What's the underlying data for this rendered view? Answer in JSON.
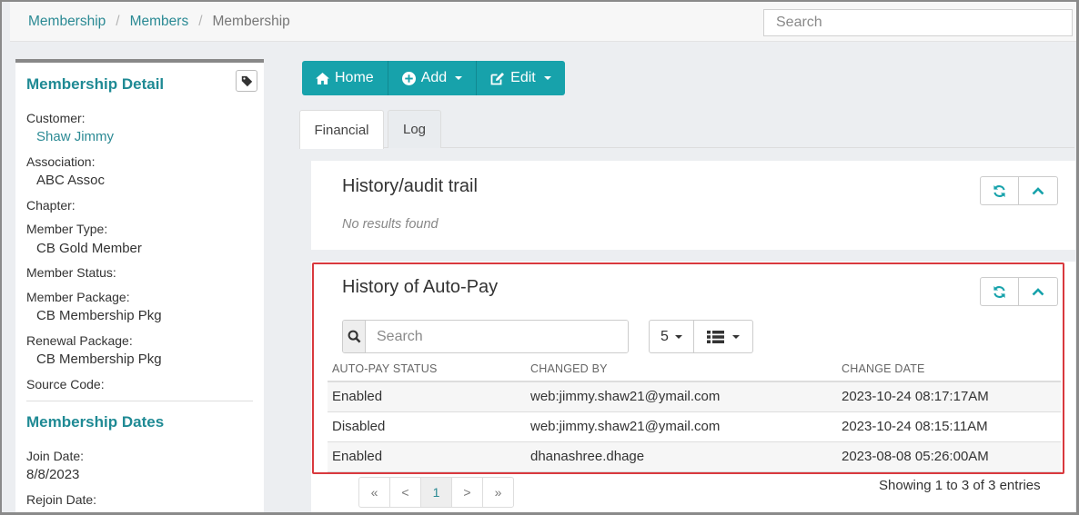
{
  "breadcrumb": {
    "items": [
      "Membership",
      "Members"
    ],
    "current": "Membership"
  },
  "top_search": {
    "placeholder": "Search"
  },
  "detail": {
    "title": "Membership Detail",
    "customer_label": "Customer:",
    "customer": "Shaw Jimmy",
    "association_label": "Association:",
    "association": "ABC Assoc",
    "chapter_label": "Chapter:",
    "member_type_label": "Member Type:",
    "member_type": "CB Gold Member",
    "member_status_label": "Member Status:",
    "member_package_label": "Member Package:",
    "member_package": "CB Membership Pkg",
    "renewal_package_label": "Renewal Package:",
    "renewal_package": "CB Membership Pkg",
    "source_code_label": "Source Code:"
  },
  "dates": {
    "title": "Membership Dates",
    "join_label": "Join Date:",
    "join": "8/8/2023",
    "rejoin_label": "Rejoin Date:"
  },
  "toolbar": {
    "home": "Home",
    "add": "Add",
    "edit": "Edit"
  },
  "tabs": [
    {
      "label": "Financial"
    },
    {
      "label": "Log"
    }
  ],
  "audit": {
    "title": "History/audit trail",
    "empty": "No results found"
  },
  "autopay": {
    "title": "History of Auto-Pay",
    "search_placeholder": "Search",
    "page_size": "5",
    "columns": [
      "AUTO-PAY STATUS",
      "CHANGED BY",
      "CHANGE DATE"
    ],
    "rows": [
      {
        "status": "Enabled",
        "by": "web:jimmy.shaw21@ymail.com",
        "date": "2023-10-24 08:17:17AM"
      },
      {
        "status": "Disabled",
        "by": "web:jimmy.shaw21@ymail.com",
        "date": "2023-10-24 08:15:11AM"
      },
      {
        "status": "Enabled",
        "by": "dhanashree.dhage",
        "date": "2023-08-08 05:26:00AM"
      }
    ],
    "pager": {
      "first": "«",
      "prev": "<",
      "page": "1",
      "next": ">",
      "last": "»"
    },
    "showing": "Showing 1 to 3 of 3 entries"
  },
  "colors": {
    "accent": "#17a2ab",
    "link": "#2b8a94",
    "highlight": "#d9393e"
  }
}
